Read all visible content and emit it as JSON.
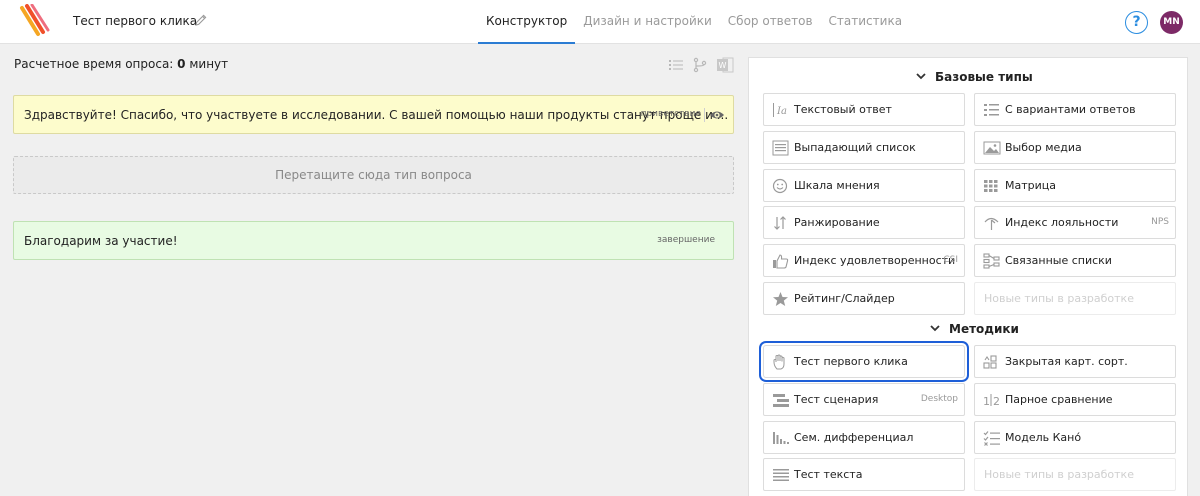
{
  "header": {
    "survey_title": "Тест первого клика",
    "tabs": [
      {
        "label": "Конструктор",
        "active": true
      },
      {
        "label": "Дизайн и настройки",
        "active": false
      },
      {
        "label": "Сбор ответов",
        "active": false
      },
      {
        "label": "Статистика",
        "active": false
      }
    ],
    "help": "?",
    "avatar": "MN",
    "accent": "#2b7cd3",
    "avatar_color": "#7d2a67"
  },
  "builder": {
    "estimate_label": "Расчетное время опроса:",
    "estimate_value": "0",
    "estimate_unit": "минут",
    "greeting": {
      "text": "Здравствуйте! Спасибо, что участвуете в исследовании. С вашей помощью наши продукты станут проще и ...",
      "tag": "приветствие"
    },
    "drop_zone": "Перетащите сюда тип вопроса",
    "closing": {
      "text": "Благодарим за участие!",
      "tag": "завершение"
    }
  },
  "panel": {
    "basic_title": "Базовые типы",
    "methods_title": "Методики",
    "basic": [
      {
        "label": "Текстовый ответ",
        "icon": "text-icon"
      },
      {
        "label": "С вариантами ответов",
        "icon": "list-options-icon"
      },
      {
        "label": "Выпадающий список",
        "icon": "dropdown-icon"
      },
      {
        "label": "Выбор медиа",
        "icon": "image-icon"
      },
      {
        "label": "Шкала мнения",
        "icon": "smiley-icon"
      },
      {
        "label": "Матрица",
        "icon": "grid-icon"
      },
      {
        "label": "Ранжирование",
        "icon": "sort-icon"
      },
      {
        "label": "Индекс лояльности",
        "icon": "gauge-icon",
        "badge": "NPS"
      },
      {
        "label": "Индекс удовлетворенности",
        "icon": "thumbs-up-icon",
        "badge": "CSI"
      },
      {
        "label": "Связанные списки",
        "icon": "linked-lists-icon"
      },
      {
        "label": "Рейтинг/Слайдер",
        "icon": "star-icon"
      },
      {
        "label": "Новые типы в разработке",
        "disabled": true
      }
    ],
    "methods": [
      {
        "label": "Тест первого клика",
        "icon": "hand-pointer-icon",
        "highlight": true
      },
      {
        "label": "Закрытая карт. сорт.",
        "icon": "card-sort-icon"
      },
      {
        "label": "Тест сценария",
        "icon": "scenario-icon",
        "badge": "Desktop"
      },
      {
        "label": "Парное сравнение",
        "icon": "pair-compare-icon"
      },
      {
        "label": "Сем. дифференциал",
        "icon": "bar-scale-icon"
      },
      {
        "label": "Модель Кано́",
        "icon": "checklist-icon"
      },
      {
        "label": "Тест текста",
        "icon": "text-block-icon"
      },
      {
        "label": "Новые типы в разработке",
        "disabled": true
      }
    ]
  }
}
